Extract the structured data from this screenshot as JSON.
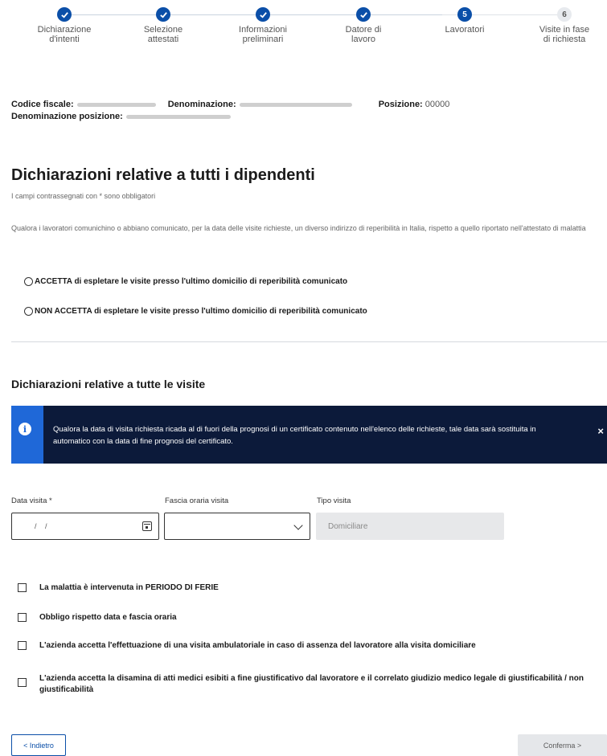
{
  "stepper": {
    "steps": [
      {
        "label": "Dichiarazione\nd'intenti",
        "state": "done",
        "number": ""
      },
      {
        "label": "Selezione\nattestati",
        "state": "done",
        "number": ""
      },
      {
        "label": "Informazioni\npreliminari",
        "state": "done",
        "number": ""
      },
      {
        "label": "Datore di\nlavoro",
        "state": "done",
        "number": ""
      },
      {
        "label": "Lavoratori",
        "state": "active",
        "number": "5"
      },
      {
        "label": "Visite in fase\ndi richiesta",
        "state": "todo",
        "number": "6"
      }
    ]
  },
  "info": {
    "codice_fiscale_label": "Codice fiscale:",
    "denominazione_label": "Denominazione:",
    "posizione_label": "Posizione:",
    "posizione_value": "00000",
    "denominazione_posizione_label": "Denominazione posizione:"
  },
  "section1": {
    "title": "Dichiarazioni relative a tutti i dipendenti",
    "required_note": "I campi contrassegnati con * sono obbligatori",
    "description": "Qualora i lavoratori comunichino o abbiano comunicato, per la data delle visite richieste, un diverso indirizzo di reperibilità in Italia, rispetto a quello riportato nell'attestato di malattia",
    "option_accept": "ACCETTA di espletare le visite presso l'ultimo domicilio di reperibilità comunicato",
    "option_reject": "NON ACCETTA di espletare le visite presso l'ultimo domicilio di reperibilità comunicato"
  },
  "section2": {
    "title": "Dichiarazioni relative a tutte le visite",
    "banner_text": "Qualora la data di visita richiesta ricada al di fuori della prognosi di un certificato contenuto nell'elenco delle richieste, tale data sarà sostituita in automatico con la data di fine prognosi del certificato.",
    "banner_close": "×",
    "data_visita_label": "Data visita *",
    "data_visita_value": "/ /",
    "fascia_oraria_label": "Fascia oraria visita",
    "fascia_oraria_value": "",
    "tipo_visita_label": "Tipo visita",
    "tipo_visita_value": "Domiciliare",
    "checks": [
      "La malattia è intervenuta in PERIODO DI FERIE",
      "Obbligo rispetto data e fascia oraria",
      "L'azienda accetta l'effettuazione di una visita ambulatoriale in caso di assenza del lavoratore alla visita domiciliare",
      "L'azienda accetta la disamina di atti medici esibiti a fine giustificativo dal lavoratore e il correlato giudizio medico legale di giustificabilità / non giustificabilità"
    ]
  },
  "footer": {
    "back_label": "< Indietro",
    "confirm_label": "Conferma >"
  },
  "colors": {
    "primary": "#0b4fa8",
    "banner_bg": "#0c1a3a",
    "banner_accent": "#1f68d8"
  }
}
